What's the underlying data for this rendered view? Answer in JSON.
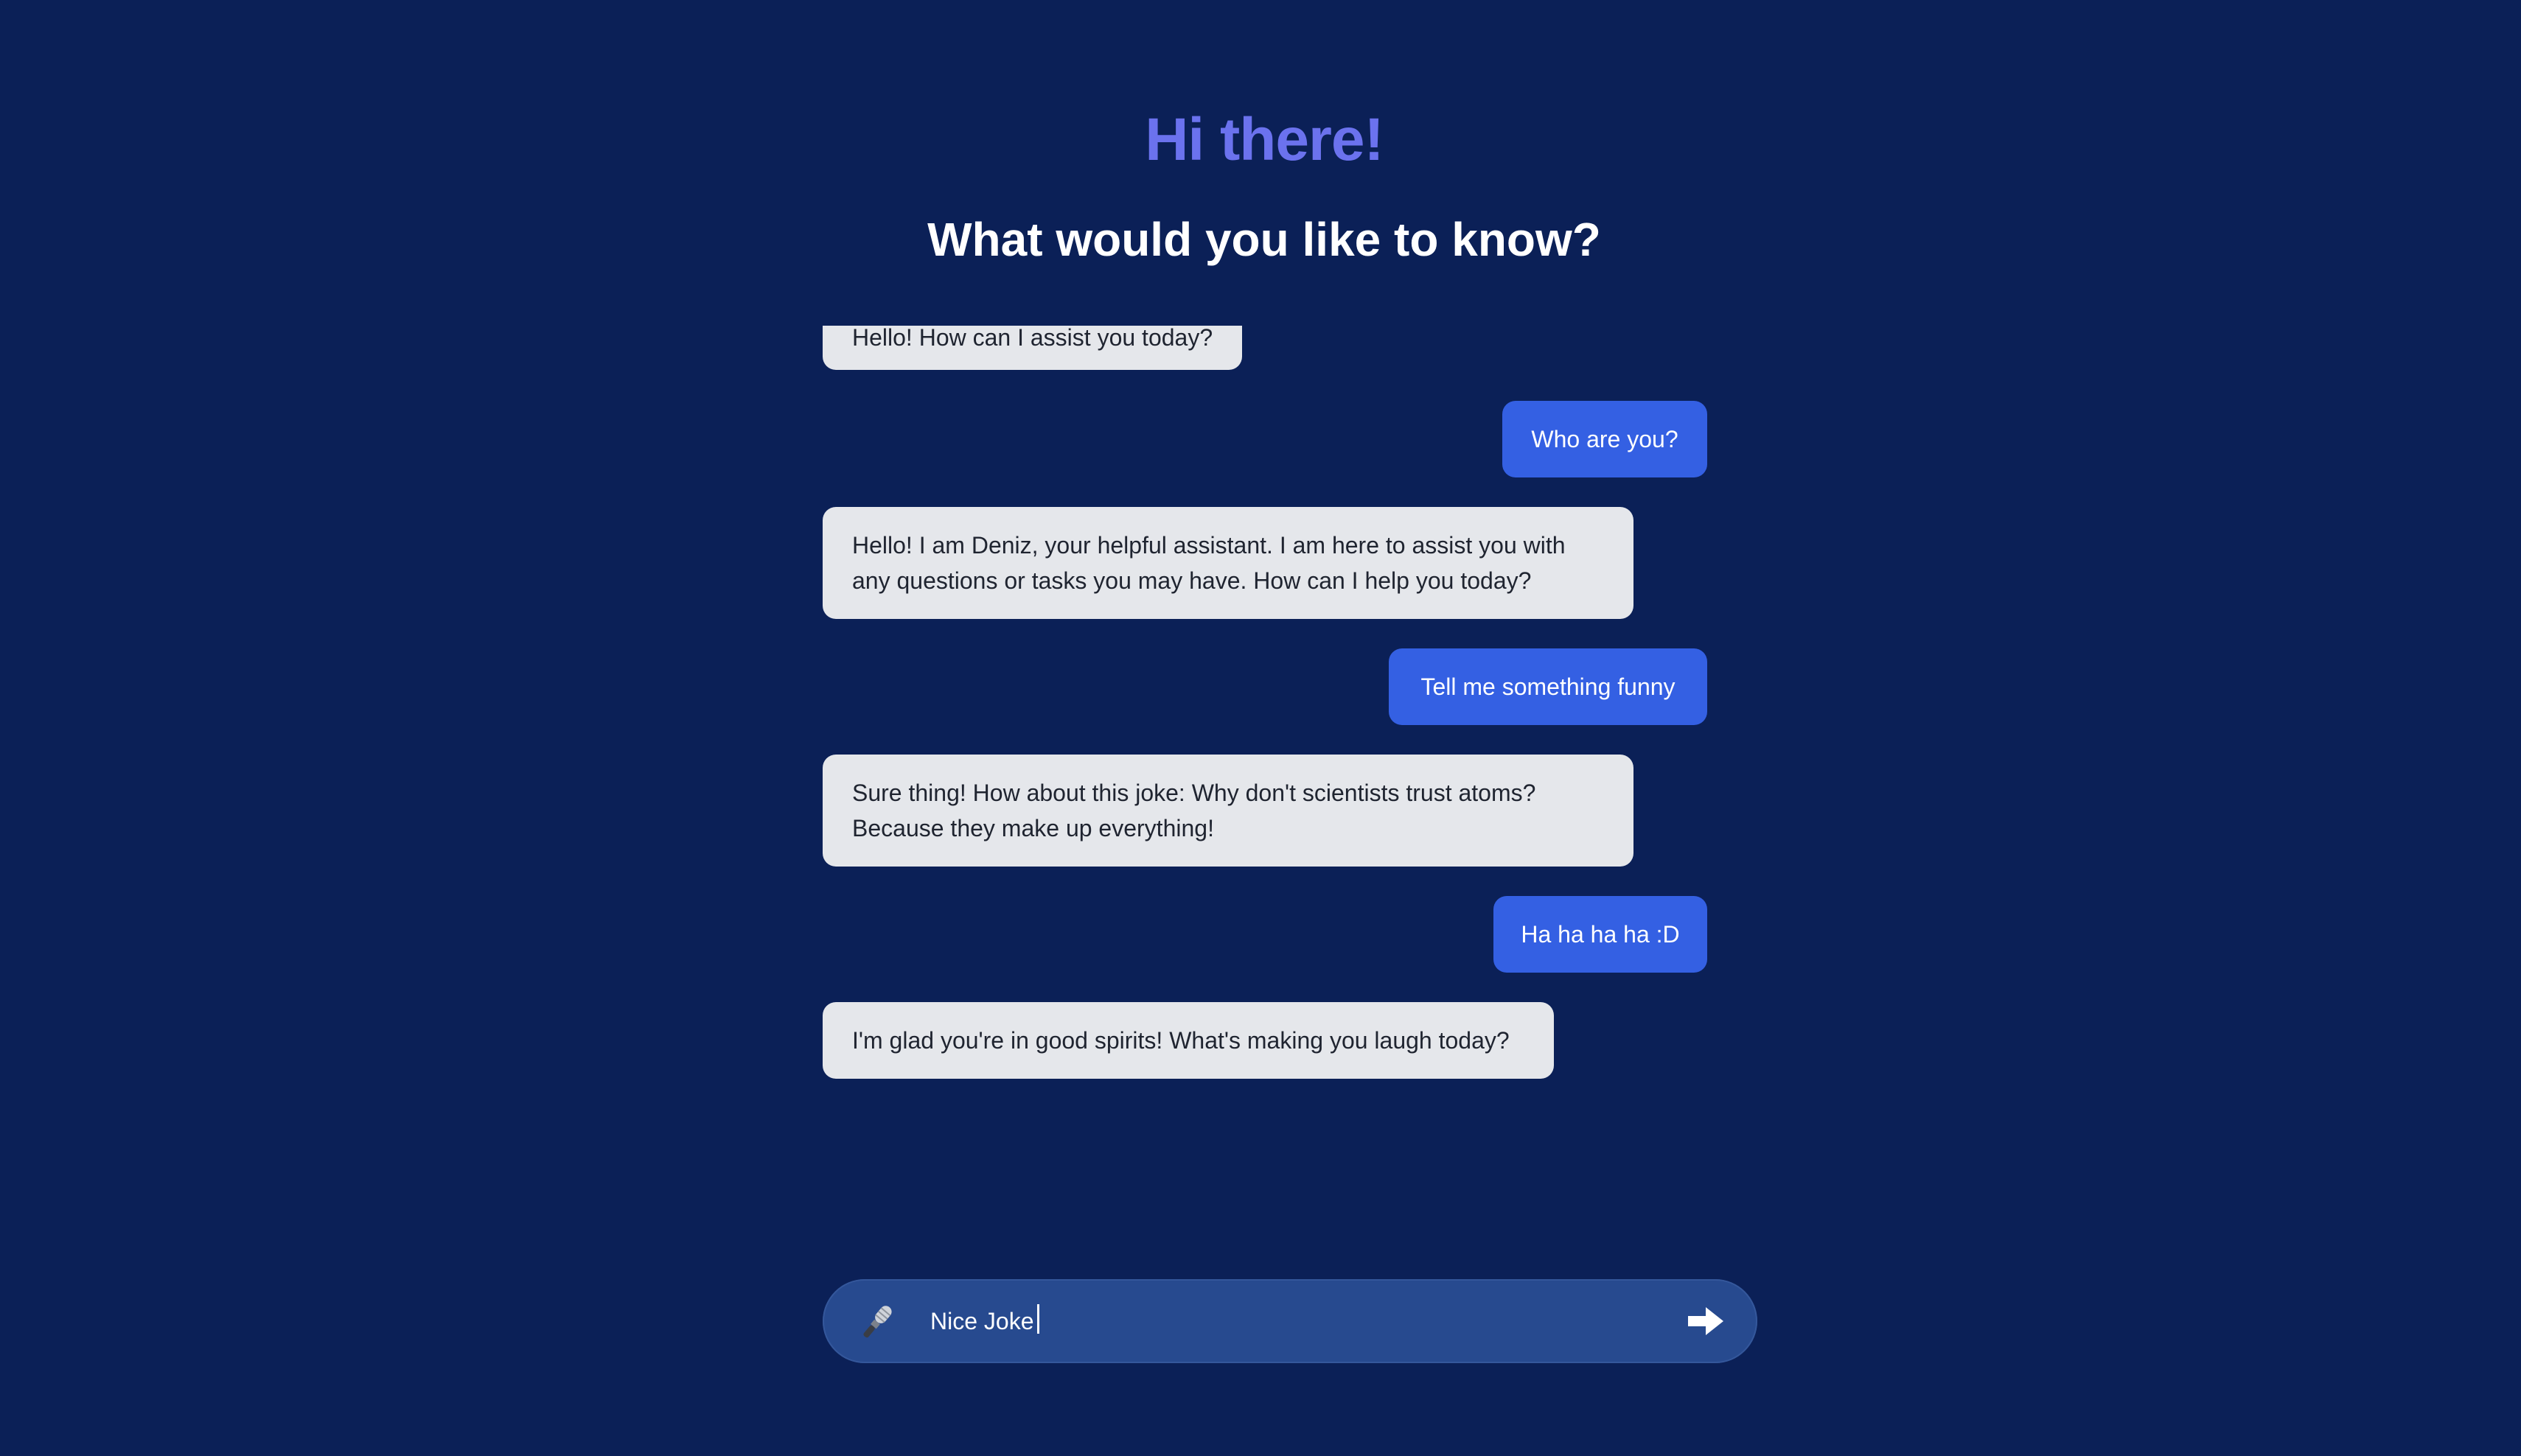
{
  "header": {
    "greeting": "Hi there!",
    "subtitle": "What would you like to know?"
  },
  "messages": [
    {
      "role": "assistant",
      "text": "Hello! How can I assist you today?"
    },
    {
      "role": "user",
      "text": "Who are you?"
    },
    {
      "role": "assistant",
      "line1": "Hello! I am Deniz, your helpful assistant. I am here to assist you with",
      "line2": "any questions or tasks you may have. How can I help you today?"
    },
    {
      "role": "user",
      "text": "Tell me something funny"
    },
    {
      "role": "assistant",
      "line1": "Sure thing! How about this joke: Why don't scientists trust atoms?",
      "line2": "Because they make up everything!"
    },
    {
      "role": "user",
      "text": "Ha ha ha ha :D"
    },
    {
      "role": "assistant",
      "text": "I'm glad you're in good spirits! What's making you laugh today?"
    }
  ],
  "composer": {
    "value": "Nice Joke",
    "mic_icon": "microphone-icon",
    "send_icon": "arrow-right-icon"
  },
  "colors": {
    "background": "#0b2057",
    "greeting": "#6b72ee",
    "user_bubble": "#3460e3",
    "assistant_bubble": "#e5e7eb",
    "composer": "#274a8f"
  }
}
